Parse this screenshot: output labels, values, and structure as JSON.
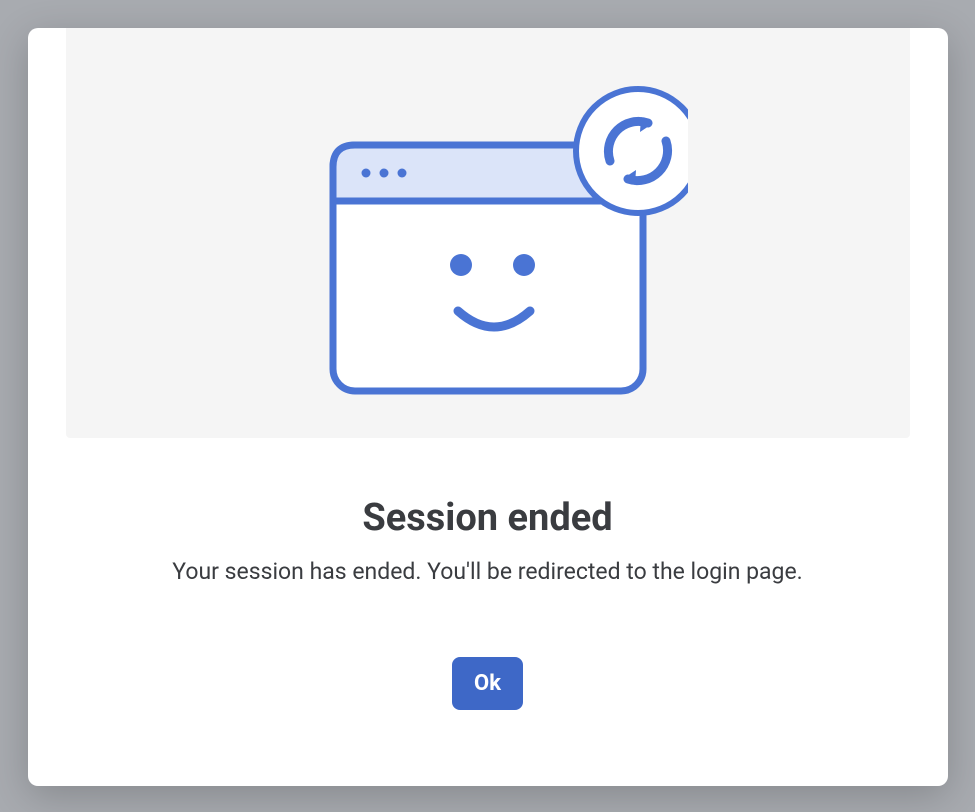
{
  "dialog": {
    "title": "Session ended",
    "message": "Your session has ended. You'll be redirected to the login page.",
    "ok_label": "Ok"
  },
  "illustration": {
    "name": "browser-refresh-smile",
    "colors": {
      "stroke": "#4a74d4",
      "fill_header": "#dbe4f9",
      "fill_body": "#ffffff"
    }
  }
}
